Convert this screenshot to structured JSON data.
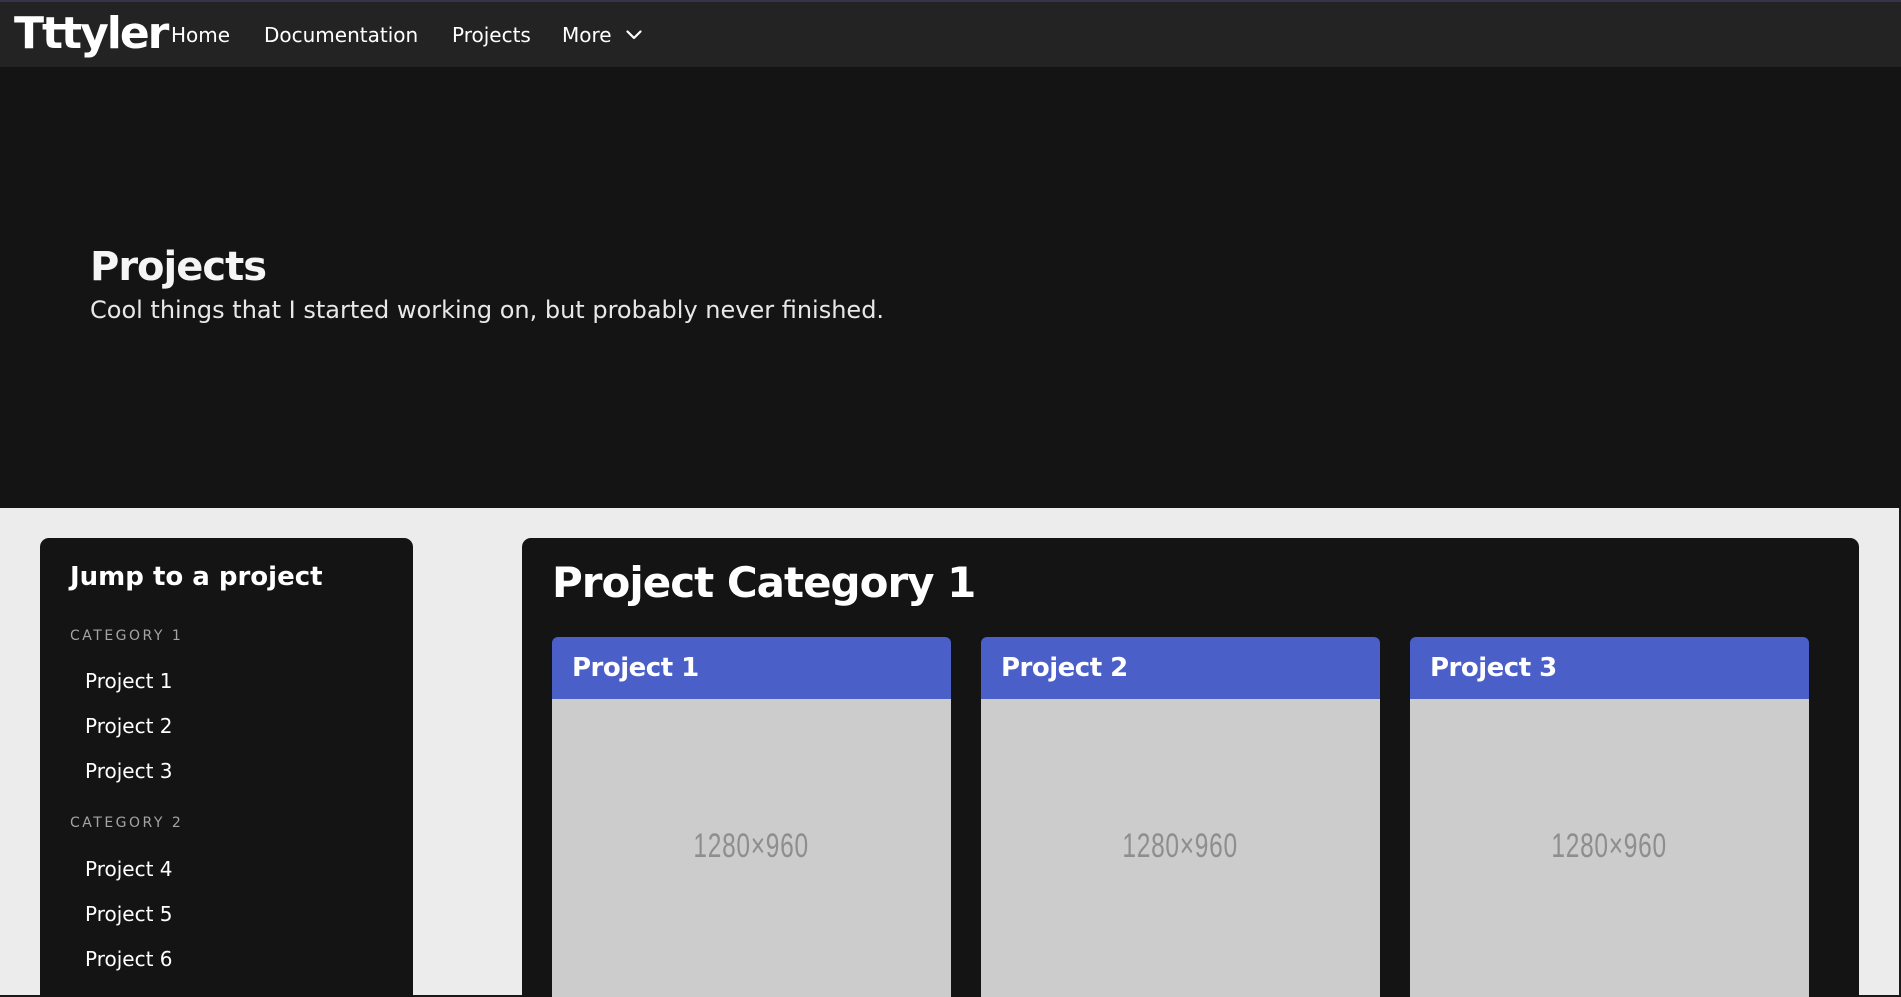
{
  "navbar": {
    "brand": "Tttyler",
    "links": [
      {
        "label": "Home"
      },
      {
        "label": "Documentation"
      },
      {
        "label": "Projects"
      },
      {
        "label": "More",
        "icon": "chevron-down-icon"
      }
    ]
  },
  "hero": {
    "title": "Projects",
    "subtitle": "Cool things that I started working on, but probably never finished."
  },
  "sidebar": {
    "title": "Jump to a project",
    "categories": [
      {
        "label": "CATEGORY 1",
        "items": [
          "Project 1",
          "Project 2",
          "Project 3"
        ]
      },
      {
        "label": "CATEGORY 2",
        "items": [
          "Project 4",
          "Project 5",
          "Project 6"
        ]
      }
    ]
  },
  "main": {
    "category_title": "Project Category 1",
    "cards": [
      {
        "title": "Project 1",
        "image_label": "1280×960"
      },
      {
        "title": "Project 2",
        "image_label": "1280×960"
      },
      {
        "title": "Project 3",
        "image_label": "1280×960"
      }
    ]
  },
  "colors": {
    "navbar_bg": "#232323",
    "hero_bg": "#141414",
    "page_bg": "#ececec",
    "card_header": "#4b5fc8",
    "placeholder": "#cccccc"
  }
}
